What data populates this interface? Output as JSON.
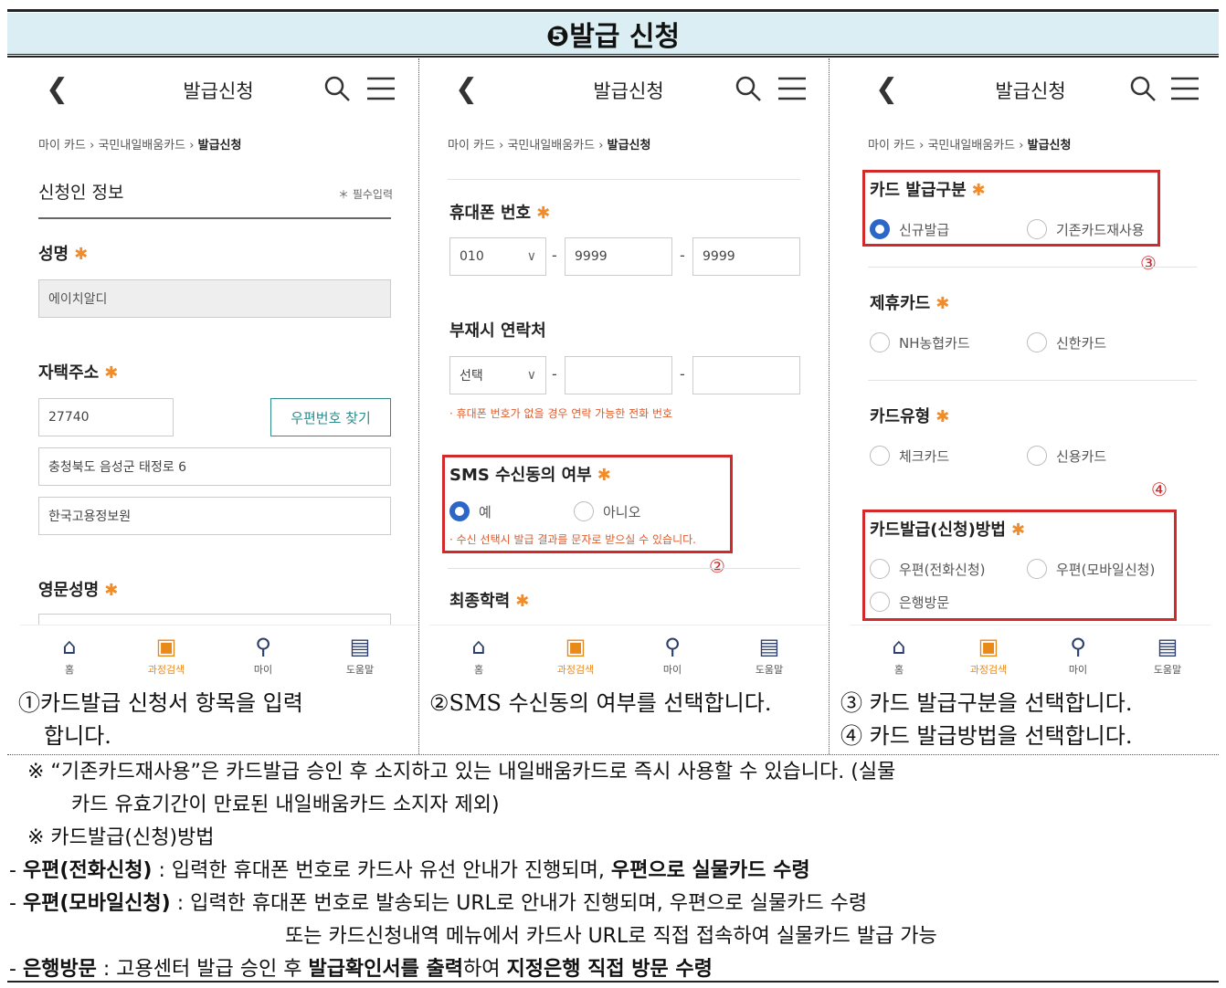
{
  "header": {
    "title": "❺발급 신청"
  },
  "panels": [
    {
      "appbar_title": "발급신청",
      "breadcrumb": {
        "a": "마이 카드",
        "b": "국민내일배움카드",
        "c": "발급신청"
      },
      "section_title": "신청인 정보",
      "required_note": "＊ 필수입력",
      "name_label": "성명",
      "name_value": "에이치알디",
      "address_label": "자택주소",
      "zip_value": "27740",
      "zip_button": "우편번호 찾기",
      "address1": "충청북도 음성군 태정로 6",
      "address2": "한국고용정보원",
      "english_name_label": "영문성명"
    },
    {
      "appbar_title": "발급신청",
      "breadcrumb": {
        "a": "마이 카드",
        "b": "국민내일배움카드",
        "c": "발급신청"
      },
      "phone_label": "휴대폰 번호",
      "phone_prefix": "010",
      "phone_mid": "9999",
      "phone_last": "9999",
      "alt_label": "부재시 연락처",
      "alt_select": "선택",
      "alt_note": "· 휴대폰 번호가 없을 경우 연락 가능한 전화 번호",
      "sms_label": "SMS 수신동의 여부",
      "sms_yes": "예",
      "sms_no": "아니오",
      "sms_note": "· 수신 선택시 발급 결과를 문자로 받으실 수 있습니다.",
      "marker": "②",
      "edu_label": "최종학력"
    },
    {
      "appbar_title": "발급신청",
      "breadcrumb": {
        "a": "마이 카드",
        "b": "국민내일배움카드",
        "c": "발급신청"
      },
      "issue_type_label": "카드 발급구분",
      "issue_new": "신규발급",
      "issue_reuse": "기존카드재사용",
      "marker3": "③",
      "partner_label": "제휴카드",
      "partner_nh": "NH농협카드",
      "partner_shinhan": "신한카드",
      "type_label": "카드유형",
      "type_check": "체크카드",
      "type_credit": "신용카드",
      "marker4": "④",
      "method_label": "카드발급(신청)방법",
      "method_phone": "우편(전화신청)",
      "method_mobile": "우편(모바일신청)",
      "method_bank": "은행방문"
    }
  ],
  "nav": {
    "home": "홈",
    "search": "과정검색",
    "my": "마이",
    "help": "도움말"
  },
  "captions": {
    "c1_line1": "①카드발급 신청서 항목을 입력",
    "c1_line2": "합니다.",
    "c2": "②SMS 수신동의 여부를 선택합니다.",
    "c3_line1": "③ 카드 발급구분을 선택합니다.",
    "c3_line2": "④ 카드 발급방법을 선택합니다."
  },
  "notes": {
    "n1a": "※ “기존카드재사용”은 카드발급 승인 후 소지하고 있는 내일배움카드로 즉시 사용할 수 있습니다. (실물",
    "n1b": "카드 유효기간이 만료된 내일배움카드 소지자 제외)",
    "n2": "※ 카드발급(신청)방법",
    "n3_bold1": "우편(전화신청)",
    "n3_text": " : 입력한 휴대폰 번호로 카드사 유선 안내가 진행되며, ",
    "n3_bold2": "우편으로 실물카드 수령",
    "n4_bold": "우편(모바일신청)",
    "n4_text": " : 입력한 휴대폰 번호로 발송되는 URL로 안내가 진행되며, 우편으로 실물카드 수령",
    "n4b": "또는 카드신청내역 메뉴에서 카드사 URL로 직접 접속하여 실물카드 발급 가능",
    "n5_bold1": "은행방문",
    "n5_text1": " : 고용센터 발급 승인 후 ",
    "n5_bold2": "발급확인서를 출력",
    "n5_text2": "하여 ",
    "n5_bold3": "지정은행 직접 방문 수령",
    "dash": "- "
  }
}
